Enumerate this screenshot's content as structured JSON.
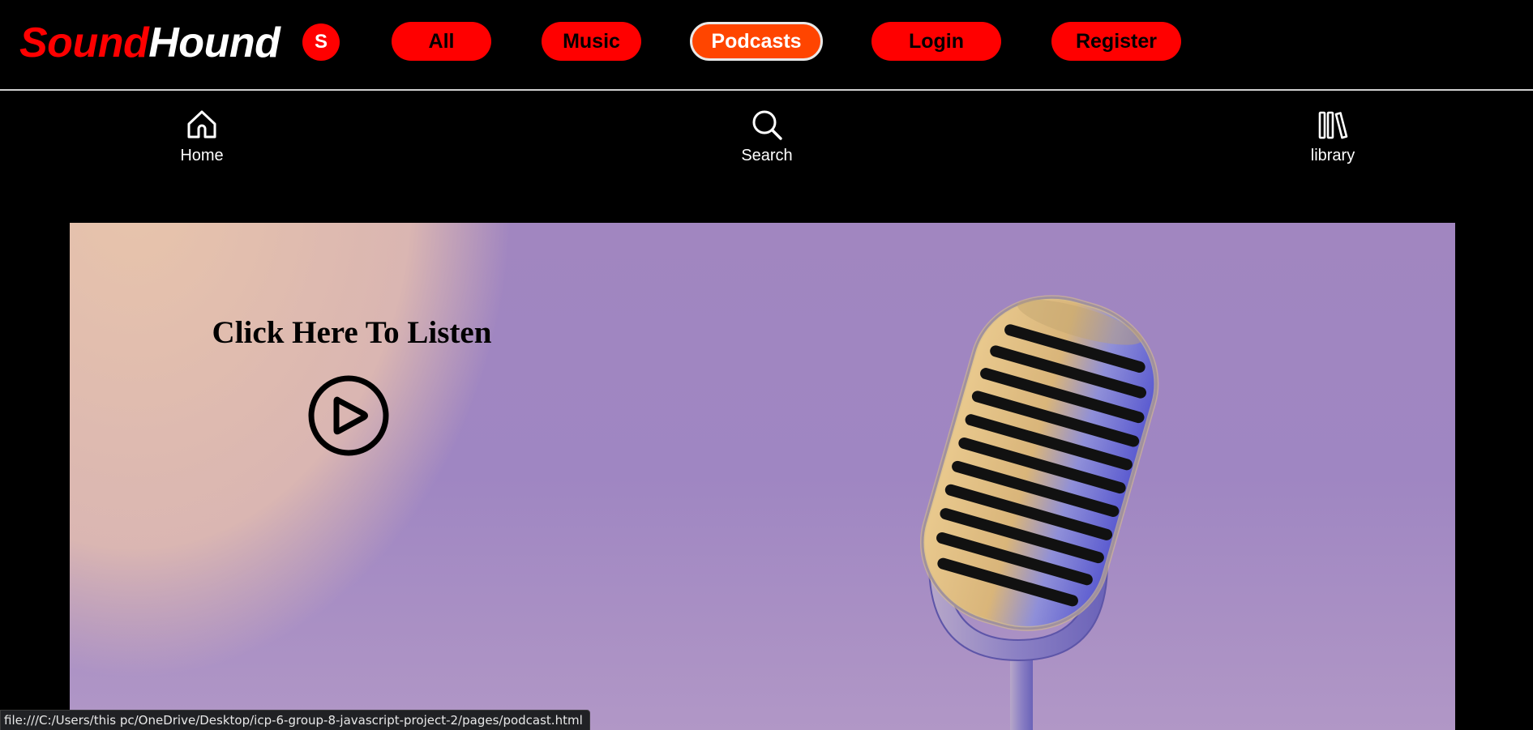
{
  "brand": {
    "part1": "Sound",
    "part2": "Hound",
    "accent_color": "#ff0000"
  },
  "user": {
    "avatar_initial": "S"
  },
  "top_nav": {
    "all": "All",
    "music": "Music",
    "podcasts": "Podcasts",
    "login": "Login",
    "register": "Register",
    "active": "Podcasts",
    "active_color": "#ff4500"
  },
  "main_nav": {
    "items": [
      {
        "label": "Home",
        "icon": "home-icon"
      },
      {
        "label": "Search",
        "icon": "search-icon"
      },
      {
        "label": "library",
        "icon": "library-icon"
      }
    ]
  },
  "hero": {
    "title": "Click Here To Listen",
    "play_icon": "play-circle-icon",
    "image": "vintage-microphone"
  },
  "status_bar": {
    "url": "file:///C:/Users/this pc/OneDrive/Desktop/icp-6-group-8-javascript-project-2/pages/podcast.html"
  }
}
